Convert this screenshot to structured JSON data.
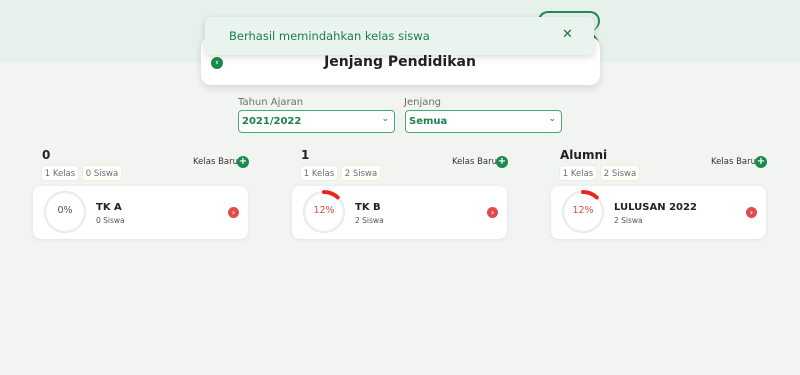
{
  "header": {
    "title": "Jenjang Pendidikan",
    "back_icon": "chevron-left-icon"
  },
  "toast": {
    "message": "Berhasil memindahkan kelas siswa",
    "close_symbol": "✕"
  },
  "filters": {
    "tahun": {
      "label": "Tahun Ajaran",
      "value": "2021/2022"
    },
    "jenjang": {
      "label": "Jenjang",
      "value": "Semua"
    }
  },
  "columns": [
    {
      "title": "0",
      "kelas_tag": "1 Kelas",
      "siswa_tag": "0 Siswa",
      "add_label": "Kelas Baru",
      "class": {
        "name": "TK A",
        "siswa": "0 Siswa",
        "percent_text": "0%",
        "percent": 0
      }
    },
    {
      "title": "1",
      "kelas_tag": "1 Kelas",
      "siswa_tag": "2 Siswa",
      "add_label": "Kelas Baru",
      "class": {
        "name": "TK B",
        "siswa": "2 Siswa",
        "percent_text": "12%",
        "percent": 12
      }
    },
    {
      "title": "Alumni",
      "kelas_tag": "1 Kelas",
      "siswa_tag": "2 Siswa",
      "add_label": "Kelas Baru",
      "class": {
        "name": "LULUSAN 2022",
        "siswa": "2 Siswa",
        "percent_text": "12%",
        "percent": 12
      }
    }
  ],
  "colors": {
    "primary": "#1a8a4c",
    "accent_red": "#e04b4b",
    "gauge_progress": "#e8261b",
    "gauge_empty": "#ececec"
  }
}
